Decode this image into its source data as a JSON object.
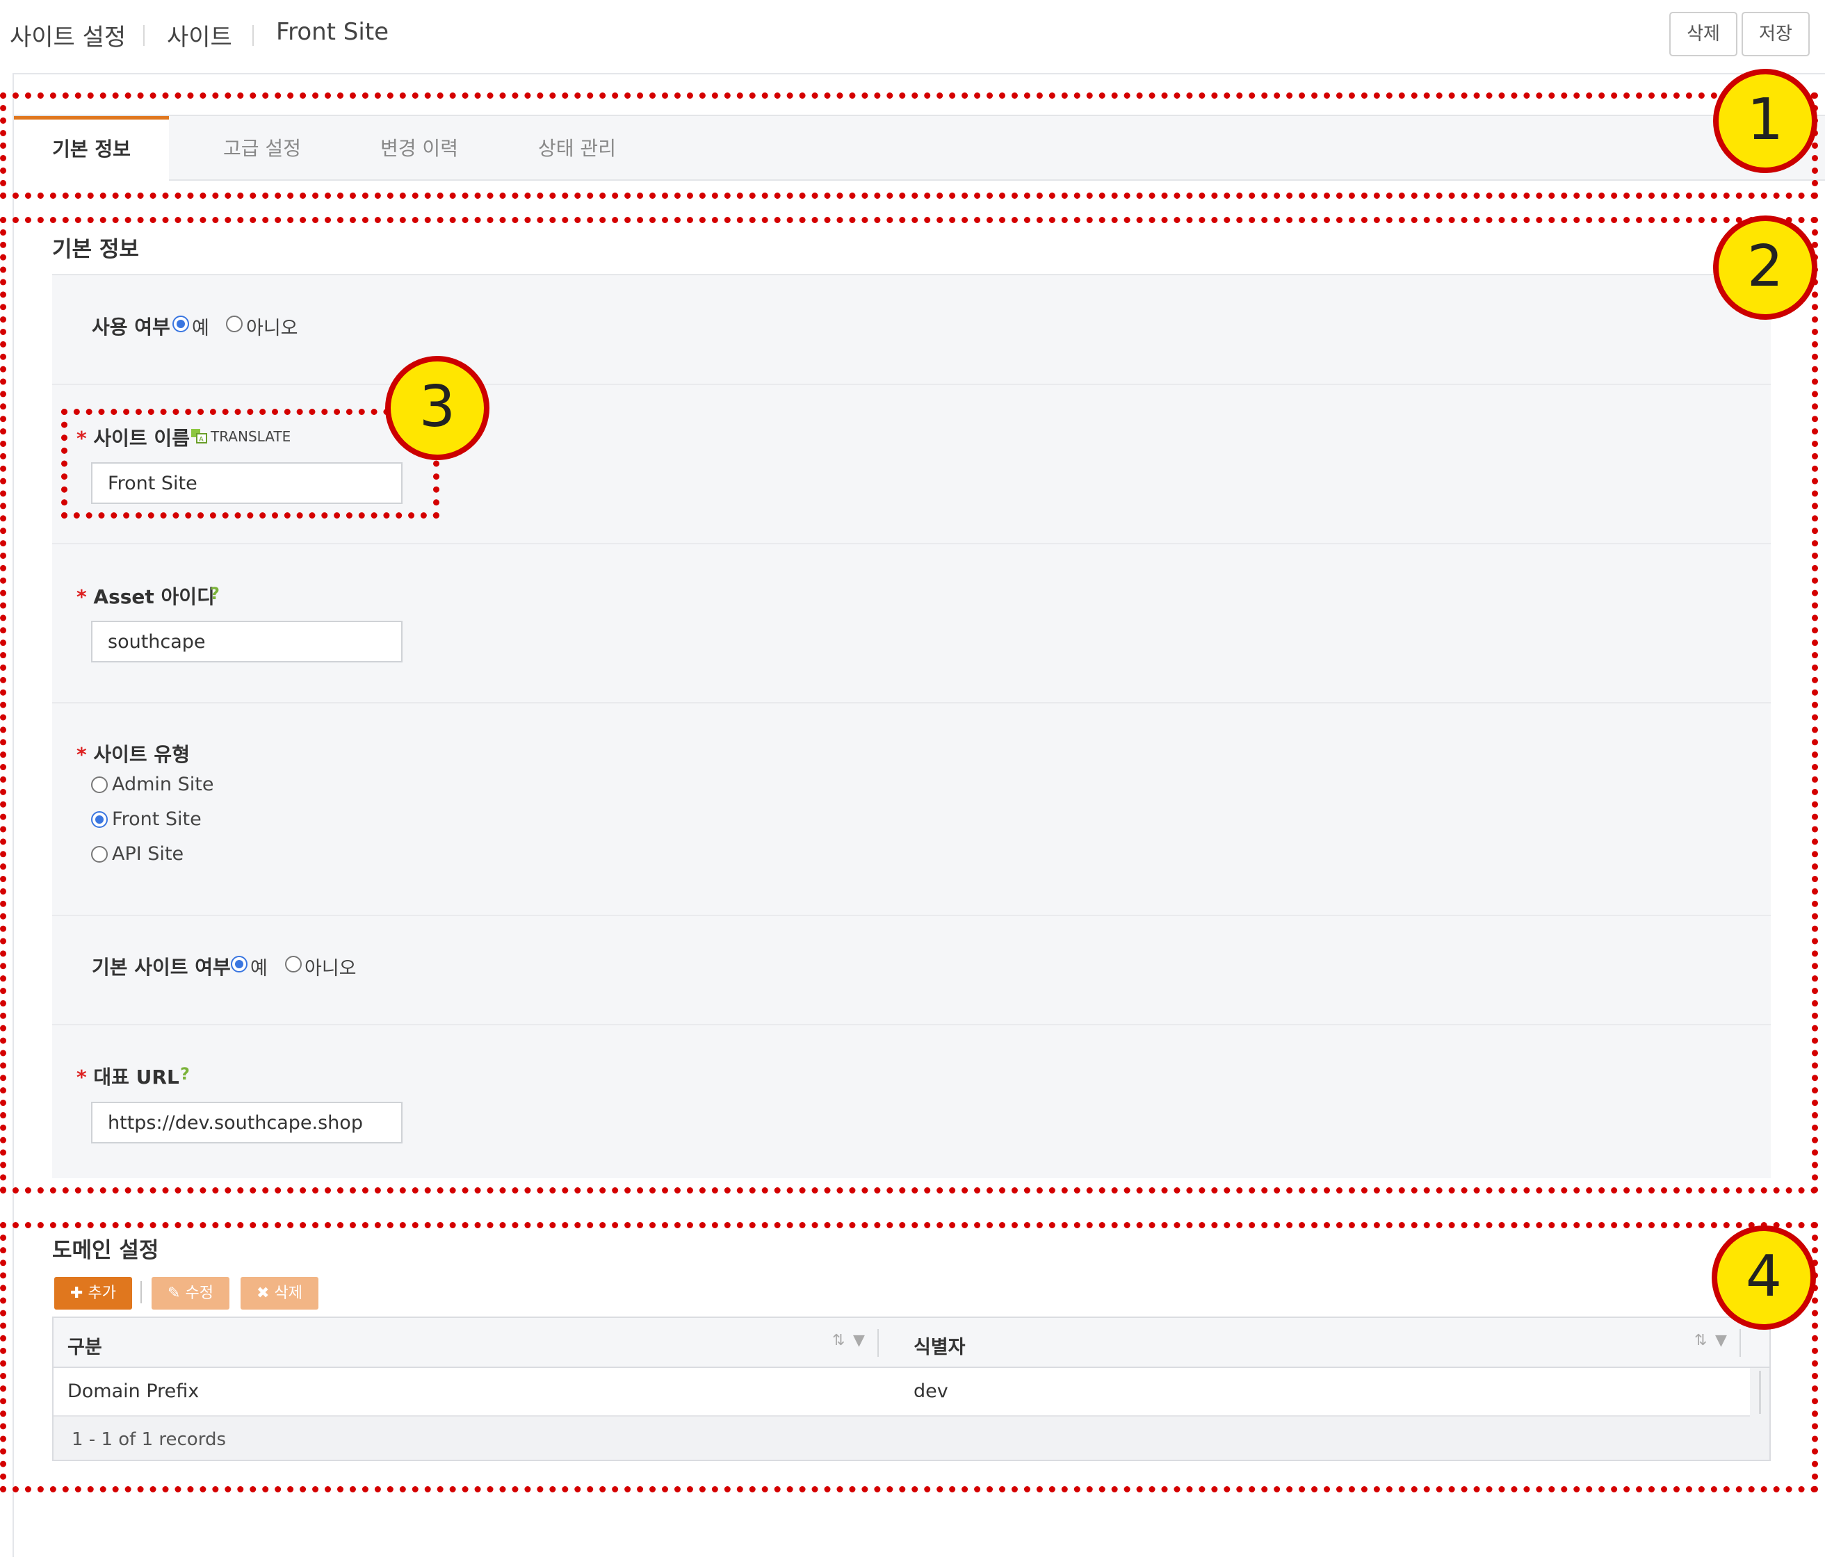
{
  "header": {
    "breadcrumb": [
      "사이트 설정",
      "사이트",
      "Front Site"
    ],
    "delete_label": "삭제",
    "save_label": "저장"
  },
  "tabs": [
    {
      "label": "기본 정보",
      "active": true
    },
    {
      "label": "고급 설정",
      "active": false
    },
    {
      "label": "변경 이력",
      "active": false
    },
    {
      "label": "상태 관리",
      "active": false
    }
  ],
  "basic": {
    "title": "기본 정보",
    "use_label": "사용 여부",
    "use_yes": "예",
    "use_no": "아니오",
    "use_value": "예",
    "name_label": "사이트 이름",
    "translate": "TRANSLATE",
    "name_value": "Front Site",
    "asset_label": "Asset 아이디",
    "asset_value": "southcape",
    "type_label": "사이트 유형",
    "type_options": [
      "Admin Site",
      "Front Site",
      "API Site"
    ],
    "type_value": "Front Site",
    "default_label": "기본 사이트 여부",
    "default_yes": "예",
    "default_no": "아니오",
    "default_value": "예",
    "url_label": "대표 URL",
    "url_value": "https://dev.southcape.shop",
    "required_mark": "*",
    "help_mark": "?"
  },
  "domain": {
    "title": "도메인 설정",
    "add_label": "추가",
    "edit_label": "수정",
    "delete_label": "삭제",
    "columns": [
      "구분",
      "식별자"
    ],
    "rows": [
      [
        "Domain Prefix",
        "dev"
      ]
    ],
    "footer": "1 - 1 of 1 records"
  },
  "annotations": [
    "1",
    "2",
    "3",
    "4"
  ],
  "colors": {
    "accent": "#e0771e",
    "annotation_border": "#d40000",
    "annotation_badge": "#ffe600",
    "radio_checked": "#3a76e0",
    "help": "#7bb33a"
  }
}
